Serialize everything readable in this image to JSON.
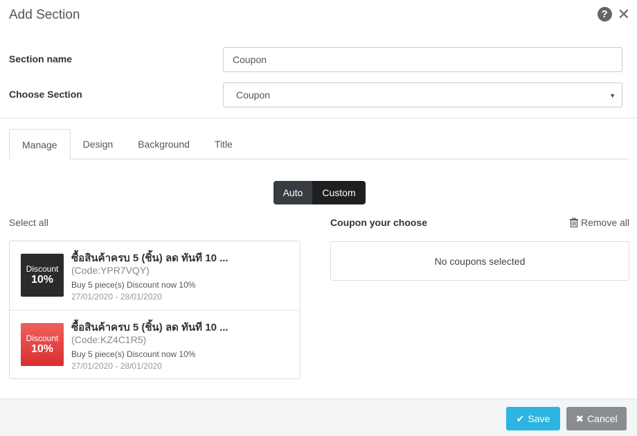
{
  "modal": {
    "title": "Add Section"
  },
  "form": {
    "section_name_label": "Section name",
    "section_name_value": "Coupon",
    "choose_section_label": "Choose Section",
    "choose_section_value": "Coupon"
  },
  "tabs": [
    {
      "label": "Manage",
      "active": true
    },
    {
      "label": "Design",
      "active": false
    },
    {
      "label": "Background",
      "active": false
    },
    {
      "label": "Title",
      "active": false
    }
  ],
  "mode_toggle": {
    "auto_label": "Auto",
    "custom_label": "Custom",
    "selected": "Custom"
  },
  "left_panel": {
    "select_all_label": "Select all",
    "coupons": [
      {
        "badge_text": "Discount",
        "badge_value": "10%",
        "badge_color": "#2b2b2b",
        "title": "ซื้อสินค้าครบ 5 (ชิ้น) ลด ทันที 10 ...",
        "code": "(Code:YPR7VQY)",
        "description": "Buy 5 piece(s) Discount now 10%",
        "dates": "27/01/2020 - 28/01/2020"
      },
      {
        "badge_text": "Discount",
        "badge_value": "10%",
        "badge_color": "#e03c3a",
        "title": "ซื้อสินค้าครบ 5 (ชิ้น) ลด ทันที 10 ...",
        "code": "(Code:KZ4C1R5)",
        "description": "Buy 5 piece(s) Discount now 10%",
        "dates": "27/01/2020 - 28/01/2020"
      }
    ]
  },
  "right_panel": {
    "heading": "Coupon your choose",
    "remove_all_label": "Remove all",
    "empty_message": "No coupons selected"
  },
  "footer": {
    "save_label": "Save",
    "cancel_label": "Cancel",
    "save_color": "#2bb5e0",
    "cancel_color": "#8a8d90"
  }
}
